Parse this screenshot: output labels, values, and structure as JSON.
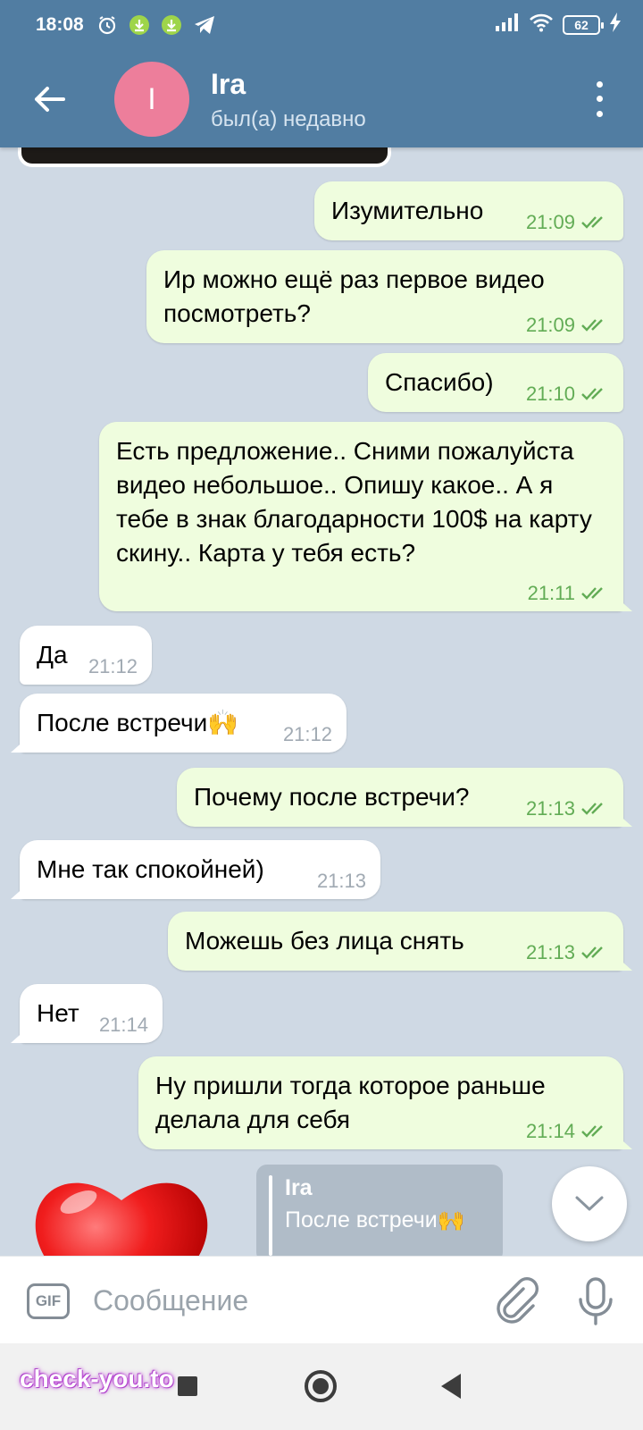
{
  "status_bar": {
    "time": "18:08",
    "icons": [
      "alarm-icon",
      "download-icon",
      "download-icon",
      "telegram-icon"
    ],
    "battery": "62",
    "right_icons": [
      "signal-icon",
      "wifi-icon",
      "battery-icon",
      "charging-icon"
    ]
  },
  "header": {
    "avatar_letter": "I",
    "contact_name": "Ira",
    "contact_status": "был(а) недавно",
    "avatar_color": "#ed7e9b",
    "bar_color": "#517da2"
  },
  "messages": [
    {
      "dir": "out",
      "text": "Изумительно",
      "time": "21:09"
    },
    {
      "dir": "out",
      "text": "Ир можно ещё раз первое видео посмотреть?",
      "time": "21:09"
    },
    {
      "dir": "out",
      "text": "Спасибо)",
      "time": "21:10"
    },
    {
      "dir": "out",
      "text": "Есть предложение.. Сними пожалуйста видео небольшое.. Опишу какое.. А я тебе в знак благодарности 100$ на карту скину.. Карта у тебя есть?",
      "time": "21:11"
    },
    {
      "dir": "in",
      "text": "Да",
      "time": "21:12"
    },
    {
      "dir": "in",
      "text": "После встречи🙌",
      "time": "21:12"
    },
    {
      "dir": "out",
      "text": "Почему после встречи?",
      "time": "21:13"
    },
    {
      "dir": "in",
      "text": "Мне так спокойней)",
      "time": "21:13"
    },
    {
      "dir": "out",
      "text": "Можешь без лица снять",
      "time": "21:13"
    },
    {
      "dir": "in",
      "text": "Нет",
      "time": "21:14"
    },
    {
      "dir": "out",
      "text": "Ну пришли тогда которое раньше делала для себя",
      "time": "21:14"
    }
  ],
  "reply_preview": {
    "name": "Ira",
    "text": "После встречи🙌"
  },
  "input": {
    "gif_label": "GIF",
    "placeholder": "Сообщение"
  },
  "watermark": "check-you.to",
  "colors": {
    "outgoing_bubble": "#effdde",
    "incoming_bubble": "#ffffff",
    "check_green": "#62ac55",
    "chat_background": "#cfd9e4"
  }
}
